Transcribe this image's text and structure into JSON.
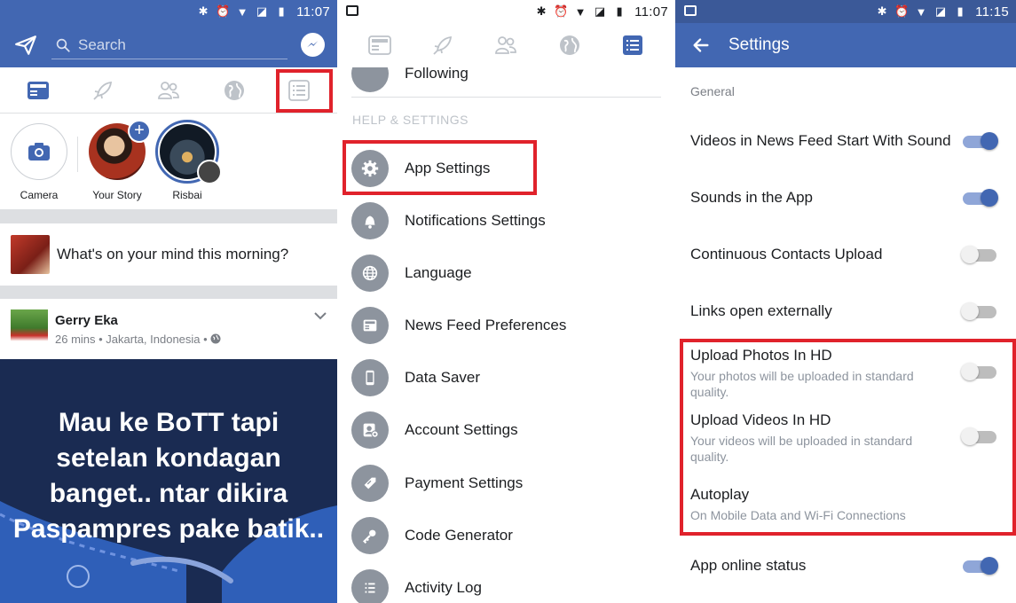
{
  "panel1": {
    "status": {
      "time": "11:07"
    },
    "search": {
      "placeholder": "Search"
    },
    "stories": [
      {
        "label": "Camera"
      },
      {
        "label": "Your Story"
      },
      {
        "label": "Risbai"
      }
    ],
    "composer": {
      "prompt": "What's on your mind this morning?"
    },
    "post": {
      "author": "Gerry Eka",
      "meta": "26 mins • Jakarta, Indonesia •",
      "text": "Mau ke BoTT tapi setelan kondagan banget.. ntar dikira Paspampres pake batik.."
    }
  },
  "panel2": {
    "status": {
      "time": "11:07"
    },
    "partial_item": "Following",
    "section_header": "HELP & SETTINGS",
    "items": [
      {
        "label": "App Settings",
        "icon": "gear-icon"
      },
      {
        "label": "Notifications Settings",
        "icon": "bell-icon"
      },
      {
        "label": "Language",
        "icon": "globe-icon"
      },
      {
        "label": "News Feed Preferences",
        "icon": "news-feed-icon"
      },
      {
        "label": "Data Saver",
        "icon": "phone-icon"
      },
      {
        "label": "Account Settings",
        "icon": "account-gear-icon"
      },
      {
        "label": "Payment Settings",
        "icon": "tag-icon"
      },
      {
        "label": "Code Generator",
        "icon": "key-icon"
      },
      {
        "label": "Activity Log",
        "icon": "list-icon"
      }
    ]
  },
  "panel3": {
    "status": {
      "time": "11:15"
    },
    "title": "Settings",
    "section": "General",
    "rows": [
      {
        "title": "Videos in News Feed Start With Sound",
        "toggle": true
      },
      {
        "title": "Sounds in the App",
        "toggle": true
      },
      {
        "title": "Continuous Contacts Upload",
        "toggle": false
      },
      {
        "title": "Links open externally",
        "toggle": false
      },
      {
        "title": "Upload Photos In HD",
        "subtitle": "Your photos will be uploaded in standard quality.",
        "toggle": false
      },
      {
        "title": "Upload Videos In HD",
        "subtitle": "Your videos will be uploaded in standard quality.",
        "toggle": false
      },
      {
        "title": "Autoplay",
        "subtitle": "On Mobile Data and Wi-Fi Connections"
      },
      {
        "title": "App online status",
        "toggle": true
      }
    ]
  },
  "colors": {
    "facebook_blue": "#4267b2",
    "highlight_red": "#e0222b",
    "menu_icon_gray": "#8d949e"
  }
}
